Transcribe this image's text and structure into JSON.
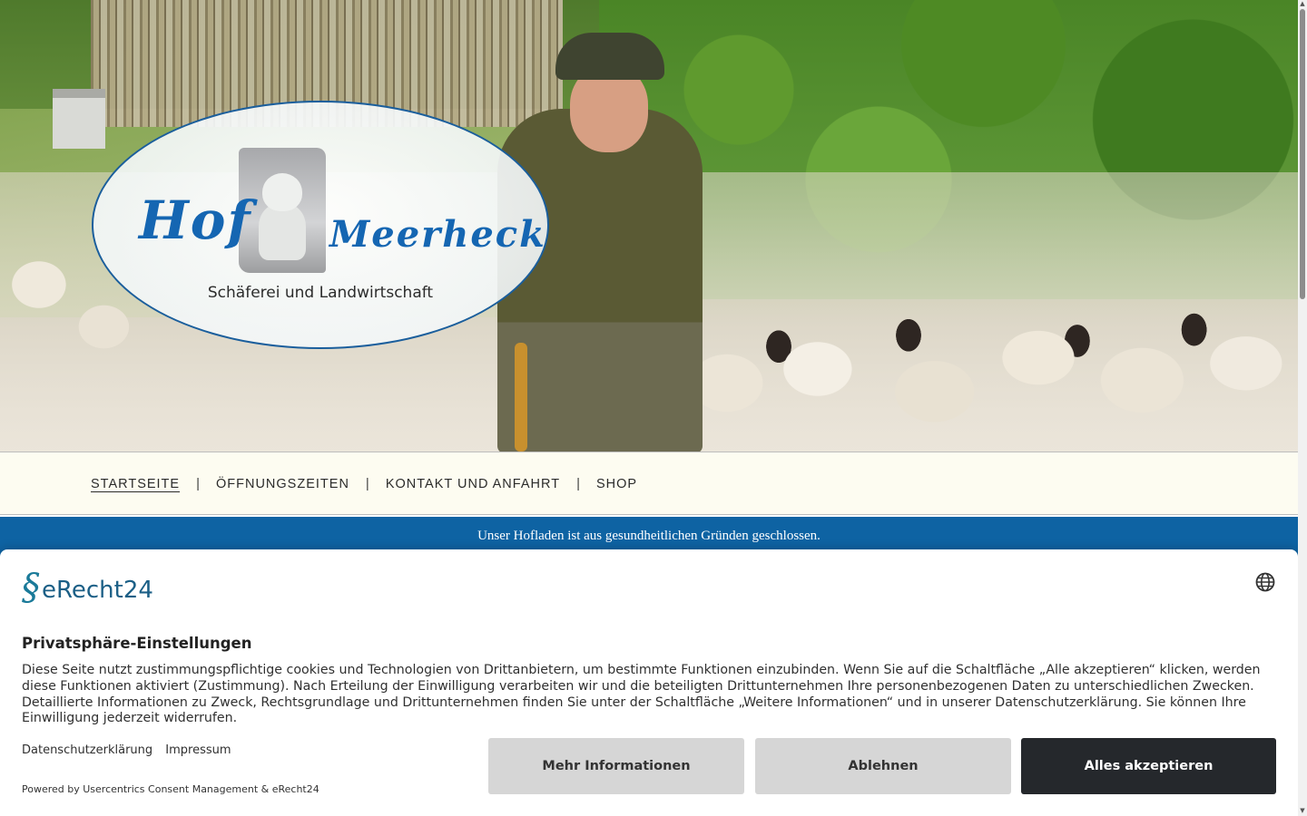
{
  "logo": {
    "word1": "Hof",
    "word2": "Meerheck",
    "subtitle": "Schäferei und Landwirtschaft"
  },
  "nav": {
    "items": [
      {
        "label": "STARTSEITE",
        "active": true
      },
      {
        "label": "ÖFFNUNGSZEITEN",
        "active": false
      },
      {
        "label": "KONTAKT UND ANFAHRT",
        "active": false
      },
      {
        "label": "SHOP",
        "active": false
      }
    ],
    "separator": "|"
  },
  "notice": {
    "text": "Unser Hofladen ist aus gesundheitlichen Gründen geschlossen."
  },
  "consent": {
    "brand": "eRecht24",
    "title": "Privatsphäre-Einstellungen",
    "body": "Diese Seite nutzt zustimmungspflichtige cookies und Technologien von Drittanbietern, um bestimmte Funktionen einzubinden. Wenn Sie auf die Schaltfläche „Alle akzeptieren“ klicken, werden diese Funktionen aktiviert (Zustimmung). Nach Erteilung der Einwilligung verarbeiten wir und die beteiligten Drittunternehmen Ihre personenbezogenen Daten zu unterschiedlichen Zwecken. Detaillierte Informationen zu Zweck, Rechtsgrundlage und Drittunternehmen finden Sie unter der Schaltfläche „Weitere Informationen“ und in unserer Datenschutzerklärung. Sie können Ihre Einwilligung jederzeit widerrufen.",
    "links": {
      "privacy": "Datenschutzerklärung",
      "imprint": "Impressum"
    },
    "powered_by": "Powered by Usercentrics Consent Management & eRecht24",
    "buttons": {
      "more": "Mehr Informationen",
      "deny": "Ablehnen",
      "accept": "Alles akzeptieren"
    },
    "language_icon": "globe-icon"
  },
  "colors": {
    "nav_background": "#fdfcf1",
    "notice_background": "#0e63a3",
    "accept_button": "#25282c",
    "secondary_button": "#d6d6d6",
    "logo_blue": "#1566b2"
  }
}
